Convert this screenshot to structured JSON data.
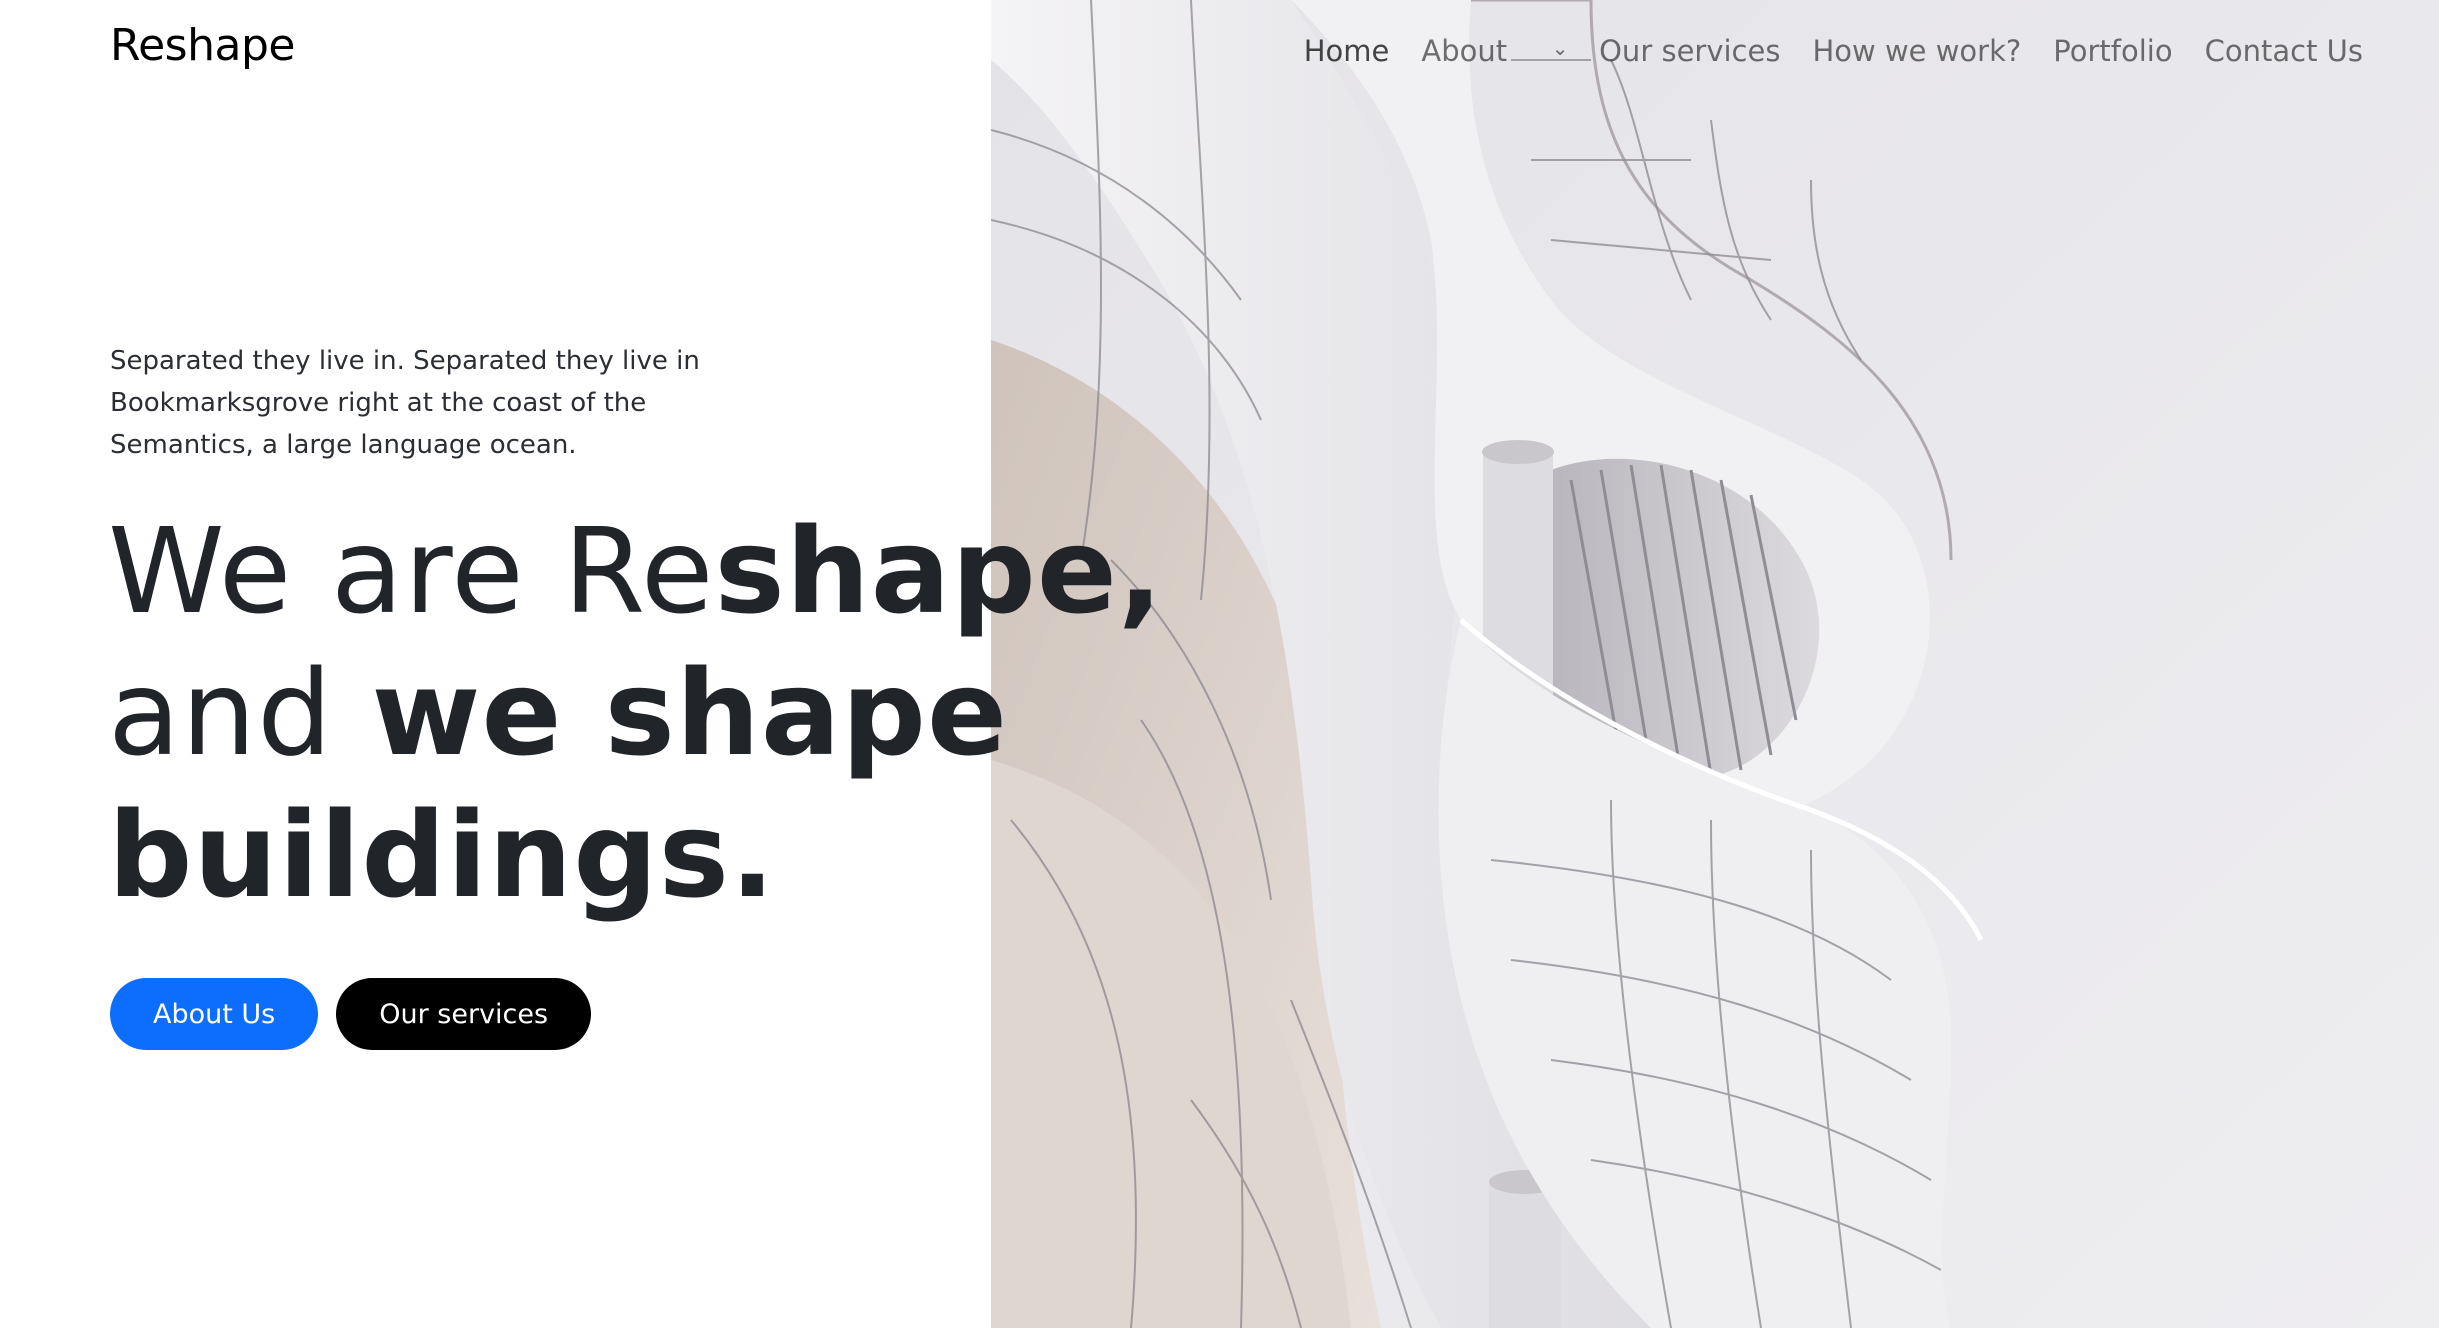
{
  "header": {
    "brand": "Reshape",
    "nav": [
      {
        "label": "Home"
      },
      {
        "label": "About"
      },
      {
        "label": "Our services"
      },
      {
        "label": "How we work?"
      },
      {
        "label": "Portfolio"
      },
      {
        "label": "Contact Us"
      }
    ]
  },
  "hero": {
    "intro": "Separated they live in. Separated they live in Bookmarksgrove right at the coast of the Semantics, a large language ocean.",
    "headline": {
      "line1_light": "We are Re",
      "line1_bold": "shape,",
      "line2_light": "and ",
      "line2_bold": "we shape",
      "line3_bold": "buildings."
    },
    "buttons": {
      "primary": "About Us",
      "secondary": "Our services"
    }
  },
  "colors": {
    "primary": "#0d6efd",
    "dark": "#000000",
    "text": "#212529"
  }
}
